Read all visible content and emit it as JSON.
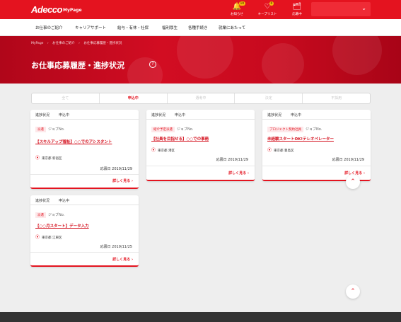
{
  "header": {
    "logo": "Adecco",
    "logo_sub": "MyPage",
    "icons": [
      {
        "name": "bell-icon",
        "glyph": "🔔",
        "label": "お知らせ",
        "badge": "10"
      },
      {
        "name": "heart-icon",
        "glyph": "♡",
        "label": "キープリスト",
        "badge": "0"
      },
      {
        "name": "folder-icon",
        "glyph": "🗂",
        "label": "応募中",
        "badge": ""
      }
    ],
    "user_chevron": "⌄"
  },
  "nav": [
    "お仕事のご紹介",
    "キャリアサポート",
    "給与・有休・社保",
    "福利厚生",
    "各種手続き",
    "就業にあたって"
  ],
  "hero": {
    "breadcrumbs": [
      "MyPage",
      "›",
      "お仕事のご紹介",
      "›",
      "お仕事応募履歴・進捗状況"
    ],
    "title": "お仕事応募履歴・進捗状況",
    "help": "?"
  },
  "tabs": [
    {
      "label": "全て",
      "active": false
    },
    {
      "label": "申込中",
      "active": true
    },
    {
      "label": "選考中",
      "active": false
    },
    {
      "label": "決定",
      "active": false
    },
    {
      "label": "不採用",
      "active": false
    }
  ],
  "cards": [
    {
      "status_label": "進捗状況",
      "status": "申込中",
      "tag": "派遣",
      "jobno": "ジョブNo.",
      "title": "【スキルアップ福祉】○○でのアシスタント",
      "location": "東京都 新宿区",
      "applied": "応募日 2019/11/29",
      "more": "詳しく見る"
    },
    {
      "status_label": "進捗状況",
      "status": "申込中",
      "tag": "紹介予定派遣",
      "jobno": "ジョブNo.",
      "title": "【社員を目指せる】○○での事務",
      "location": "東京都 港区",
      "applied": "応募日 2019/11/29",
      "more": "詳しく見る"
    },
    {
      "status_label": "進捗状況",
      "status": "申込中",
      "tag": "プロジェクト契約社員",
      "jobno": "ジョブNo.",
      "title": "未経験スタートOK!テレオペレーター",
      "location": "東京都 豊島区",
      "applied": "応募日 2019/11/29",
      "more": "詳しく見る"
    },
    {
      "status_label": "進捗状況",
      "status": "申込中",
      "tag": "派遣",
      "jobno": "ジョブNo.",
      "title": "【○○月スタート】データ入力",
      "location": "東京都 江東区",
      "applied": "応募日 2019/11/25",
      "more": "詳しく見る"
    }
  ],
  "icons": {
    "pin": "⦿",
    "chevron_right": "›",
    "scroll_up": "⌃"
  },
  "colors": {
    "brand": "#e4131f",
    "tag_bg": "#fde8ea"
  }
}
